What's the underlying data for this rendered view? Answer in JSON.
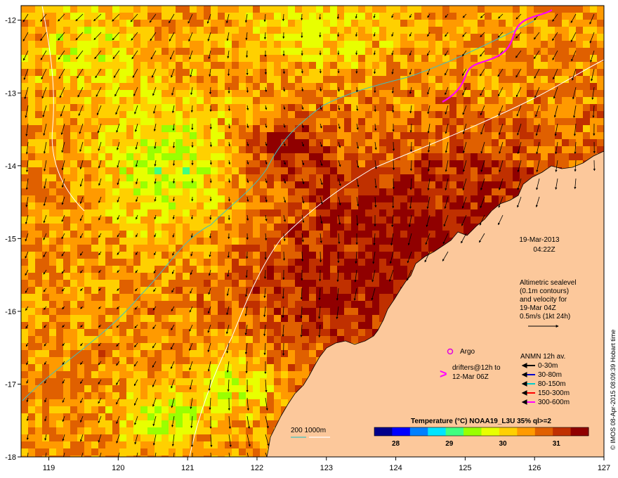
{
  "chart_data": {
    "type": "heatmap",
    "xlim": [
      118.6,
      127
    ],
    "ylim": [
      -18,
      -11.8
    ],
    "x_ticks": [
      "119",
      "120",
      "121",
      "122",
      "123",
      "124",
      "125",
      "126",
      "127"
    ],
    "y_ticks": [
      "-12",
      "-13",
      "-14",
      "-15",
      "-16",
      "-17",
      "-18"
    ],
    "colorbar": {
      "title": "Temperature (°C) NOAA19_L3U 35% ql>=2",
      "range": [
        27.6,
        31.6
      ],
      "tick_labels": [
        "28",
        "29",
        "30",
        "31"
      ],
      "colors": [
        "#00008b",
        "#0000ff",
        "#0080ff",
        "#00e5ff",
        "#40ff80",
        "#9aff00",
        "#e8ff00",
        "#ffd000",
        "#ff9a00",
        "#e06000",
        "#c03000",
        "#900000"
      ]
    }
  },
  "annotations": {
    "date": "19-Mar-2013",
    "time": "04:22Z",
    "altimetry_lines": [
      "Altimetric sealevel",
      "(0.1m contours)",
      "and velocity for",
      "19-Mar 04Z",
      "0.5m/s (1kt 24h)"
    ],
    "argo_label": "Argo",
    "drifter_lines": [
      "drifters@12h to",
      "12-Mar 06Z"
    ],
    "anmn_title": "ANMN 12h av.",
    "anmn_items": [
      {
        "label": "0-30m",
        "color": "#000000"
      },
      {
        "label": "30-80m",
        "color": "#0000cc"
      },
      {
        "label": "80-150m",
        "color": "#00cccc"
      },
      {
        "label": "150-300m",
        "color": "#ff0000"
      },
      {
        "label": "300-600m",
        "color": "#ff00ff"
      }
    ],
    "bathy_label": "200  1000m",
    "credit": "© IMOS 08-Apr-2015 08:09:39 Hobart time"
  },
  "colors": {
    "land": "#fcc89b",
    "argo": "#e000e0",
    "drifter": "#ff00ff",
    "bathy_200": "#40c0c0",
    "bathy_1000": "#ffffff"
  }
}
